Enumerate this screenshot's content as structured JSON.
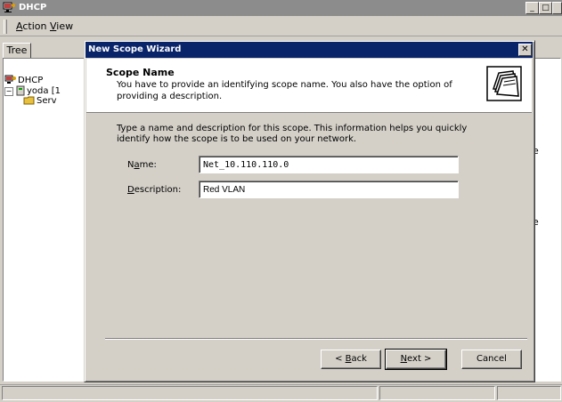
{
  "main_window": {
    "title": "DHCP",
    "menu": {
      "action": "Action",
      "view": "View"
    },
    "tree_tab": "Tree",
    "tree": [
      {
        "label": "DHCP"
      },
      {
        "label": "yoda [1"
      },
      {
        "label": "Serv"
      }
    ],
    "right_pane_letters": [
      "e",
      "e"
    ]
  },
  "wizard": {
    "title": "New Scope Wizard",
    "header": {
      "title": "Scope Name",
      "description": "You have to provide an identifying scope name. You also have the option of providing a description."
    },
    "body_text": "Type a name and description for this scope. This information helps you quickly identify how the scope is to be used on your network.",
    "name_label": {
      "underlined": "a",
      "before": "N",
      "after": "me:"
    },
    "name_value": "Net_10.110.110.0",
    "description_label": {
      "underlined": "D",
      "after": "escription:"
    },
    "description_value": "Red VLAN",
    "buttons": {
      "back": {
        "prefix": "< ",
        "underlined": "B",
        "rest": "ack"
      },
      "next": {
        "underlined": "N",
        "rest": "ext >"
      },
      "cancel": "Cancel"
    }
  },
  "colors": {
    "active_title": "#0a246a",
    "inactive_title": "#8c8c8c",
    "face": "#d4d0c8"
  }
}
